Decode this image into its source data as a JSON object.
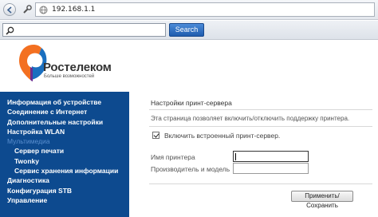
{
  "browser": {
    "url": "192.168.1.1",
    "search_button": "Search",
    "search_value": ""
  },
  "logo": {
    "name": "Ростелеком",
    "tagline": "Больше возможностей",
    "colors": {
      "orange": "#f37021",
      "blue": "#1a6fbf",
      "purple": "#6a2c91"
    }
  },
  "menu": [
    {
      "label": "Информация об устройстве",
      "active": false,
      "sub": false
    },
    {
      "label": "Соединение с Интернет",
      "active": false,
      "sub": false
    },
    {
      "label": "Дополнительные настройки",
      "active": false,
      "sub": false
    },
    {
      "label": "Настройка WLAN",
      "active": false,
      "sub": false
    },
    {
      "label": "Мультимедиа",
      "active": true,
      "sub": false
    },
    {
      "label": "Сервер печати",
      "active": false,
      "sub": true
    },
    {
      "label": "Twonky",
      "active": false,
      "sub": true
    },
    {
      "label": "Сервис хранения информации",
      "active": false,
      "sub": true
    },
    {
      "label": "Диагностика",
      "active": false,
      "sub": false
    },
    {
      "label": "Конфигурация STB",
      "active": false,
      "sub": false
    },
    {
      "label": "Управление",
      "active": false,
      "sub": false
    }
  ],
  "content": {
    "title": "Настройки принт-сервера",
    "description": "Эта страница позволяет включить/отключить поддержку принтера.",
    "enable_label": "Включить встроенный принт-сервер.",
    "enable_checked": true,
    "printer_name_label": "Имя принтера",
    "printer_name_value": "",
    "manufacturer_label": "Производитель и модель",
    "manufacturer_value": "",
    "apply_button": "Применить/Сохранить"
  },
  "colors": {
    "sidebar_bg": "#0d4a8f",
    "menu_active": "#5a8fcf",
    "search_button": "#2f6fc2"
  }
}
